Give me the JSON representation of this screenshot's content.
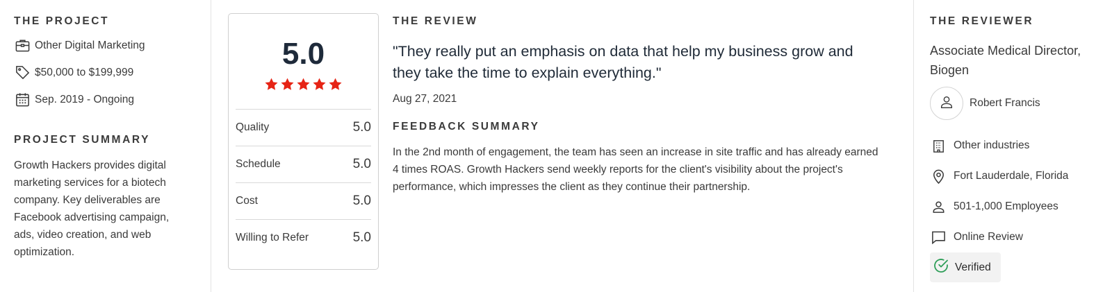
{
  "project": {
    "section_title": "THE PROJECT",
    "service": "Other Digital Marketing",
    "budget": "$50,000 to $199,999",
    "duration": "Sep. 2019 - Ongoing",
    "summary_title": "PROJECT SUMMARY",
    "summary": "Growth Hackers provides digital marketing services for a biotech company. Key deliverables are Facebook advertising campaign, ads, video creation, and web optimization."
  },
  "scores": {
    "overall": "5.0",
    "stars": 5,
    "star_color": "#e62415",
    "rows": [
      {
        "label": "Quality",
        "value": "5.0"
      },
      {
        "label": "Schedule",
        "value": "5.0"
      },
      {
        "label": "Cost",
        "value": "5.0"
      },
      {
        "label": "Willing to Refer",
        "value": "5.0"
      }
    ]
  },
  "review": {
    "section_title": "THE REVIEW",
    "quote": "\"They really put an emphasis on data that help my business grow and they take the time to explain everything.\"",
    "date": "Aug 27, 2021",
    "feedback_title": "FEEDBACK SUMMARY",
    "feedback": "In the 2nd month of engagement, the team has seen an increase in site traffic and has already earned 4 times ROAS. Growth Hackers send weekly reports for the client's visibility about the project's performance, which impresses the client as they continue their partnership."
  },
  "reviewer": {
    "section_title": "THE REVIEWER",
    "title": "Associate Medical Director, Biogen",
    "name": "Robert Francis",
    "industry": "Other industries",
    "location": "Fort Lauderdale, Florida",
    "employees": "501-1,000 Employees",
    "review_type": "Online Review",
    "verified": "Verified",
    "verified_color": "#2e9e58"
  },
  "icons": [
    "briefcase-icon",
    "price-tag-icon",
    "calendar-icon",
    "star-icon",
    "user-icon",
    "building-icon",
    "location-pin-icon",
    "person-icon",
    "chat-bubble-icon",
    "check-circle-icon"
  ]
}
